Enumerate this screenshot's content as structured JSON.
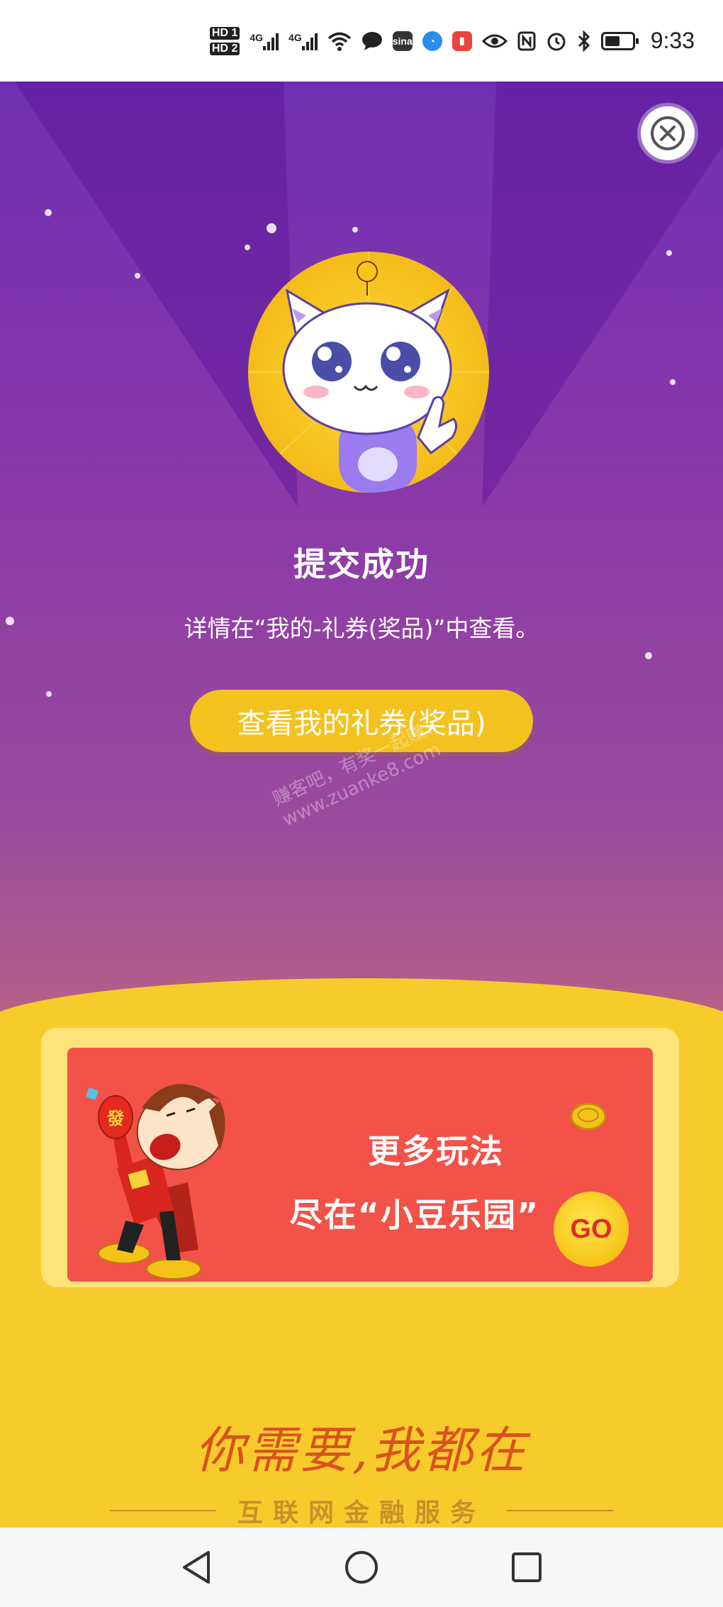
{
  "status_bar": {
    "sim1": "HD 1",
    "sim2": "HD 2",
    "net1": "4G",
    "net2": "4G",
    "time": "9:33"
  },
  "dialog": {
    "title": "提交成功",
    "message": "详情在“我的-礼券(奖品)”中查看。",
    "view_button": "查看我的礼券(奖品)"
  },
  "watermark": {
    "line1": "赚客吧，有奖一起赚！",
    "line2": "www.zuanke8.com"
  },
  "promo": {
    "title": "更多玩法",
    "subtitle": "尽在“小豆乐园”",
    "go_label": "GO",
    "badge_char": "發"
  },
  "footer": {
    "slogan": "你需要,我都在",
    "service": "互联网金融服务"
  },
  "colors": {
    "accent_yellow": "#f4c21f",
    "banner_red": "#f25247",
    "purple": "#6f2fb2"
  }
}
